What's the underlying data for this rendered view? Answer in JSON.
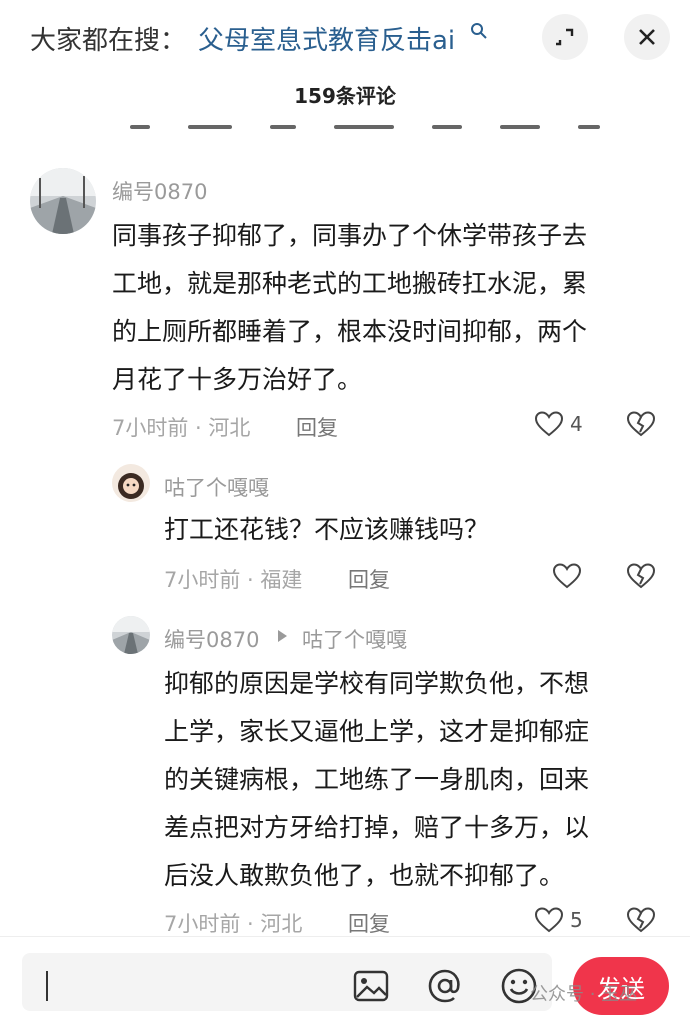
{
  "header": {
    "search_prefix": "大家都在搜：",
    "search_term": "父母室息式教育反击ai",
    "comment_count": "159条评论"
  },
  "comments": [
    {
      "username": "编号0870",
      "lines": [
        "同事孩子抑郁了，同事办了个休学带孩子去",
        "工地，就是那种老式的工地搬砖扛水泥，累",
        "的上厕所都睡着了，根本没时间抑郁，两个",
        "月花了十多万治好了。"
      ],
      "meta": "7小时前 · 河北",
      "reply_label": "回复",
      "likes": "4"
    },
    {
      "username": "咕了个嘎嘎",
      "lines": [
        "打工还花钱？不应该赚钱吗？"
      ],
      "meta": "7小时前 · 福建",
      "reply_label": "回复",
      "likes": ""
    },
    {
      "username": "编号0870",
      "reply_to": "咕了个嘎嘎",
      "lines": [
        "抑郁的原因是学校有同学欺负他，不想",
        "上学，家长又逼他上学，这才是抑郁症",
        "的关键病根，工地练了一身肌肉，回来",
        "差点把对方牙给打掉，赔了十多万，以",
        "后没人敢欺负他了，也就不抑郁了。"
      ],
      "meta": "7小时前 · 河北",
      "reply_label": "回复",
      "likes": "5"
    }
  ],
  "input_bar": {
    "send_label": "发送"
  },
  "watermark": "公众号 · 玉巫",
  "colors": {
    "accent": "#f0354b",
    "search_term": "#2a5f8f",
    "meta_text": "#a6a6a6"
  }
}
